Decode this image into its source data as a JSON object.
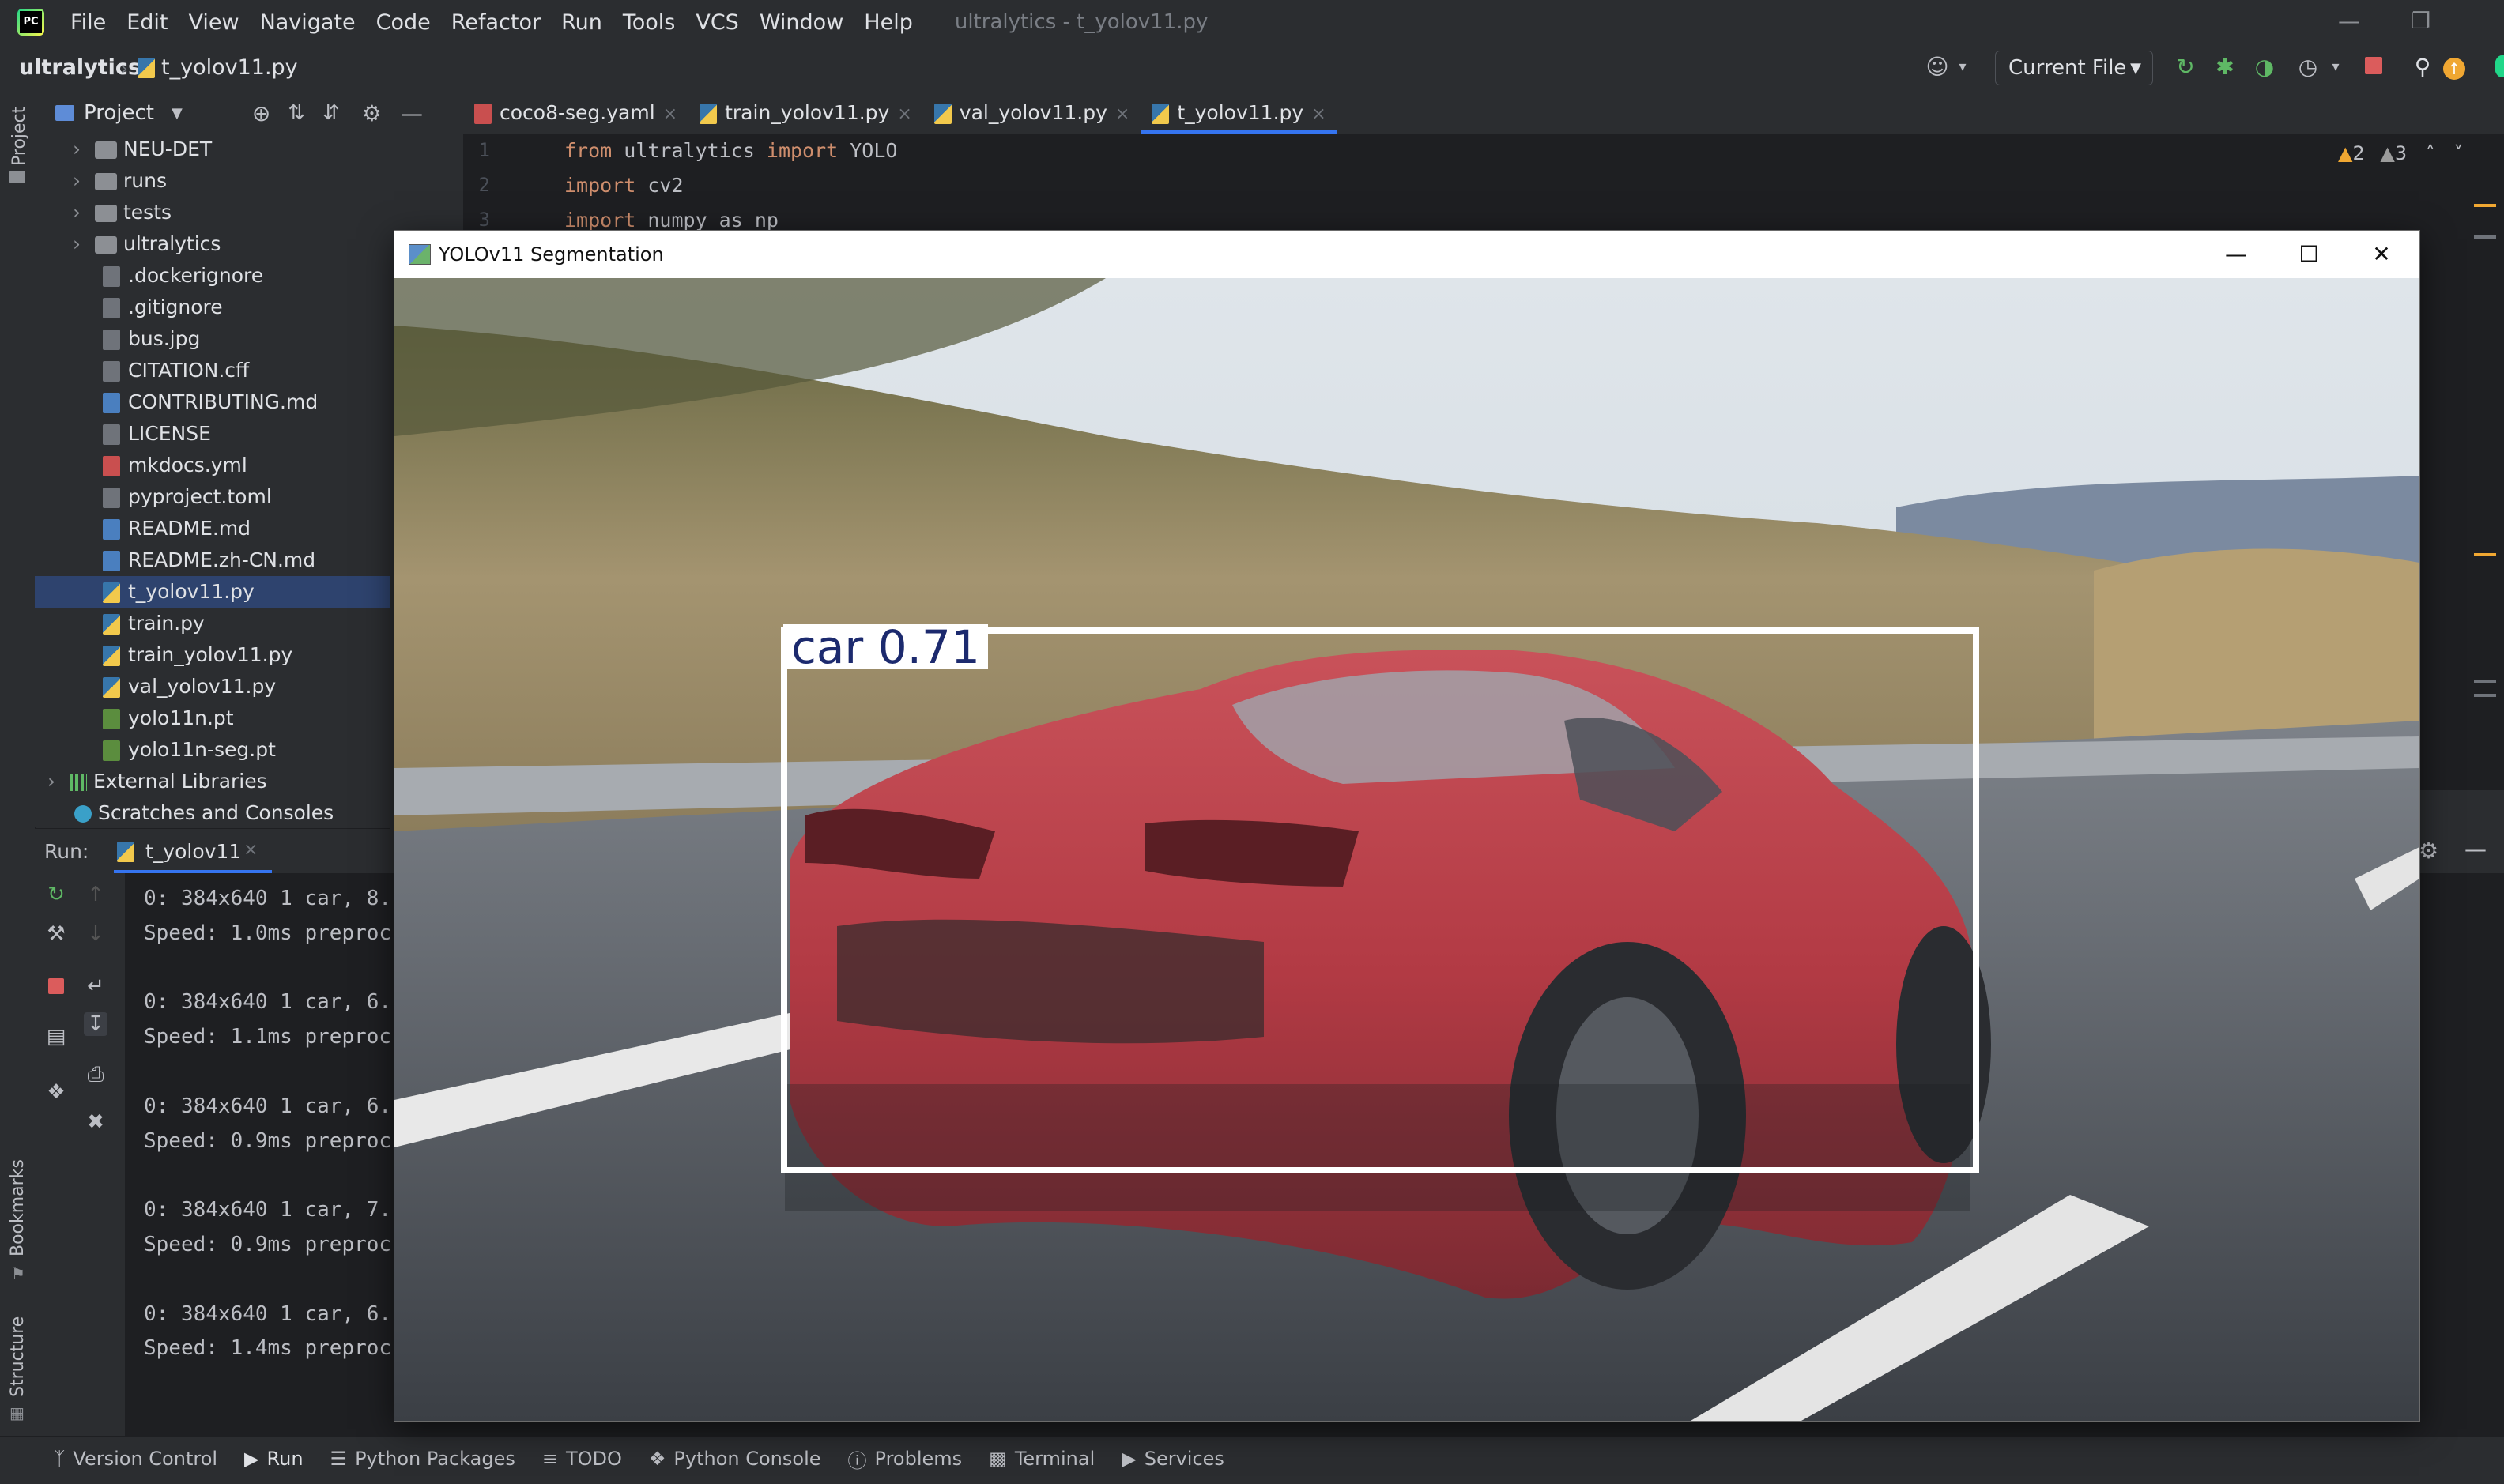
{
  "menubar": {
    "items": [
      "File",
      "Edit",
      "View",
      "Navigate",
      "Code",
      "Refactor",
      "Run",
      "Tools",
      "VCS",
      "Window",
      "Help"
    ],
    "window_title": "ultralytics - t_yolov11.py"
  },
  "navbar": {
    "project": "ultralytics",
    "file": "t_yolov11.py",
    "run_config": "Current File"
  },
  "project_panel": {
    "title": "Project",
    "items": [
      {
        "label": "NEU-DET",
        "kind": "folder"
      },
      {
        "label": "runs",
        "kind": "folder"
      },
      {
        "label": "tests",
        "kind": "folder"
      },
      {
        "label": "ultralytics",
        "kind": "folder"
      },
      {
        "label": ".dockerignore",
        "kind": "file"
      },
      {
        "label": ".gitignore",
        "kind": "file"
      },
      {
        "label": "bus.jpg",
        "kind": "file"
      },
      {
        "label": "CITATION.cff",
        "kind": "file"
      },
      {
        "label": "CONTRIBUTING.md",
        "kind": "md"
      },
      {
        "label": "LICENSE",
        "kind": "file"
      },
      {
        "label": "mkdocs.yml",
        "kind": "yml"
      },
      {
        "label": "pyproject.toml",
        "kind": "file"
      },
      {
        "label": "README.md",
        "kind": "md"
      },
      {
        "label": "README.zh-CN.md",
        "kind": "md"
      },
      {
        "label": "t_yolov11.py",
        "kind": "py"
      },
      {
        "label": "train.py",
        "kind": "py"
      },
      {
        "label": "train_yolov11.py",
        "kind": "py"
      },
      {
        "label": "val_yolov11.py",
        "kind": "py"
      },
      {
        "label": "yolo11n.pt",
        "kind": "pt"
      },
      {
        "label": "yolo11n-seg.pt",
        "kind": "pt"
      }
    ],
    "external_libraries": "External Libraries",
    "scratches": "Scratches and Consoles"
  },
  "tabs": [
    {
      "label": "coco8-seg.yaml",
      "active": false
    },
    {
      "label": "train_yolov11.py",
      "active": false
    },
    {
      "label": "val_yolov11.py",
      "active": false
    },
    {
      "label": "t_yolov11.py",
      "active": true
    }
  ],
  "editor": {
    "lines": [
      {
        "num": "1",
        "kw": "from",
        "rest": " ultralytics ",
        "kw2": "import",
        "rest2": " YOLO"
      },
      {
        "num": "2",
        "kw": "import",
        "rest": " cv2",
        "kw2": "",
        "rest2": ""
      },
      {
        "num": "3",
        "kw": "import",
        "rest": " numpy as np",
        "kw2": "",
        "rest2": ""
      }
    ],
    "warnings": "2",
    "weak_warnings": "3"
  },
  "run_panel": {
    "label": "Run:",
    "tab": "t_yolov11",
    "lines": [
      "0: 384x640 1 car, 8.",
      "Speed: 1.0ms preproc",
      "",
      "0: 384x640 1 car, 6.",
      "Speed: 1.1ms preproc",
      "",
      "0: 384x640 1 car, 6.",
      "Speed: 0.9ms preproc",
      "",
      "0: 384x640 1 car, 7.",
      "Speed: 0.9ms preproc",
      "",
      "0: 384x640 1 car, 6.",
      "Speed: 1.4ms preproc"
    ]
  },
  "left_strip": {
    "project": "Project",
    "bookmarks": "Bookmarks",
    "structure": "Structure"
  },
  "bottom_bar": {
    "tabs": [
      "Version Control",
      "Run",
      "Python Packages",
      "TODO",
      "Python Console",
      "Problems",
      "Terminal",
      "Services"
    ]
  },
  "cv_window": {
    "title": "YOLOv11 Segmentation",
    "detection_label": "car 0.71"
  },
  "colors": {
    "accent": "#3574f0",
    "selection": "#2e436e",
    "keyword": "#cf8e6d",
    "mask": "#d2323c"
  }
}
